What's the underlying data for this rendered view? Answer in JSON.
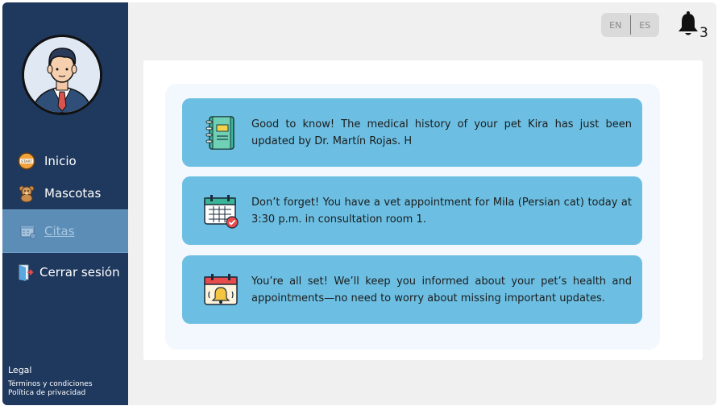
{
  "sidebar": {
    "items": [
      {
        "label": "Inicio",
        "icon": "start-badge-icon"
      },
      {
        "label": "Mascotas",
        "icon": "teddy-bear-icon"
      },
      {
        "label": "Citas",
        "icon": "appointment-calendar-icon",
        "active": true
      },
      {
        "label": "Cerrar sesión",
        "icon": "logout-door-icon"
      }
    ],
    "legal_title": "Legal",
    "legal_links": [
      "Términos y condiciones",
      "Política de privacidad"
    ]
  },
  "header": {
    "languages": [
      "EN",
      "ES"
    ],
    "notification_count": "3"
  },
  "notifications": [
    {
      "icon": "medical-notebook-icon",
      "text": "Good to know! The medical history of your pet Kira has just been updated by Dr. Martín Rojas. H"
    },
    {
      "icon": "calendar-check-icon",
      "text": "Don’t forget! You have a vet appointment for Mila (Persian cat) today at 3:30 p.m. in consultation room 1."
    },
    {
      "icon": "calendar-alarm-icon",
      "text": "You’re all set! We’ll keep you informed about your pet’s health and appointments—no need to worry about missing important updates."
    }
  ],
  "colors": {
    "sidebar": "#1f385d",
    "active_item": "#5b8db7",
    "card": "#6cbfe3",
    "inner_panel": "#f2f8fd"
  }
}
